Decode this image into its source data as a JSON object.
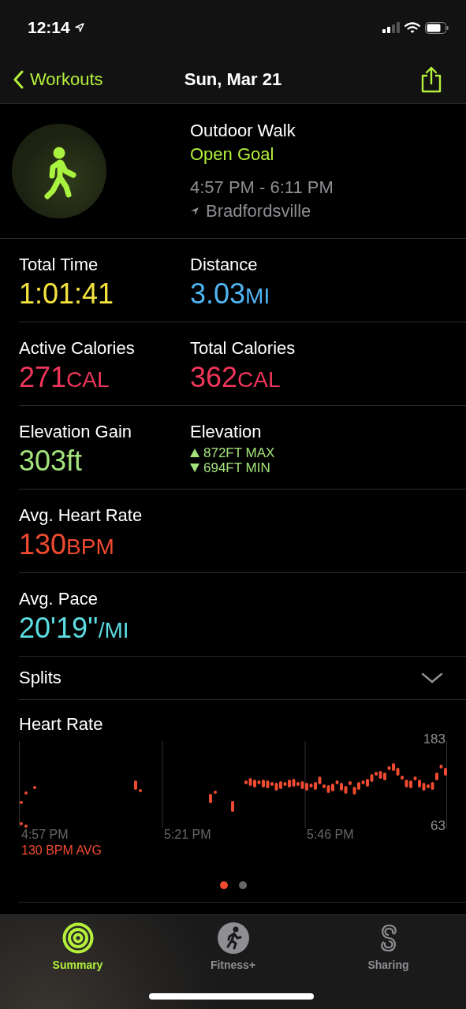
{
  "status_bar": {
    "time": "12:14"
  },
  "nav": {
    "back": "Workouts",
    "title": "Sun, Mar 21"
  },
  "workout": {
    "type": "Outdoor Walk",
    "goal": "Open Goal",
    "time_range": "4:57 PM - 6:11 PM",
    "location": "Bradfordsville"
  },
  "metric_rows": [
    [
      {
        "kind": "value",
        "label": "Total Time",
        "value": "1:01:41",
        "color": "#f4e13f"
      },
      {
        "kind": "value",
        "label": "Distance",
        "value": "3.03",
        "unit": "MI",
        "color": "#4fb5f2"
      }
    ],
    [
      {
        "kind": "value",
        "label": "Active Calories",
        "value": "271",
        "unit": "CAL",
        "color": "#f0365b"
      },
      {
        "kind": "value",
        "label": "Total Calories",
        "value": "362",
        "unit": "CAL",
        "color": "#f0365b"
      }
    ],
    [
      {
        "kind": "value",
        "label": "Elevation Gain",
        "value": "303ft",
        "color": "#a3e27c"
      },
      {
        "kind": "range",
        "label": "Elevation",
        "max": "872FT MAX",
        "min": "694FT MIN",
        "color": "#a3e27c"
      }
    ],
    [
      {
        "kind": "value",
        "label": "Avg. Heart Rate",
        "value": "130",
        "unit": "BPM",
        "color": "#f04a30"
      }
    ],
    [
      {
        "kind": "value",
        "label": "Avg. Pace",
        "value": "20'19''",
        "unit": "/MI",
        "color": "#5cdde3"
      }
    ]
  ],
  "splits": {
    "label": "Splits",
    "expanded": false
  },
  "heart_rate": {
    "title": "Heart Rate",
    "y_max": "183",
    "y_min": "63",
    "time_labels": [
      "4:57 PM",
      "5:21 PM",
      "5:46 PM"
    ],
    "average": "130 BPM AVG"
  },
  "page_dots": [
    {
      "selected": true
    },
    {
      "selected": false
    }
  ],
  "tabs": [
    {
      "label": "Summary",
      "selected": true
    },
    {
      "label": "Fitness+",
      "selected": false
    },
    {
      "label": "Sharing",
      "selected": false
    }
  ]
}
